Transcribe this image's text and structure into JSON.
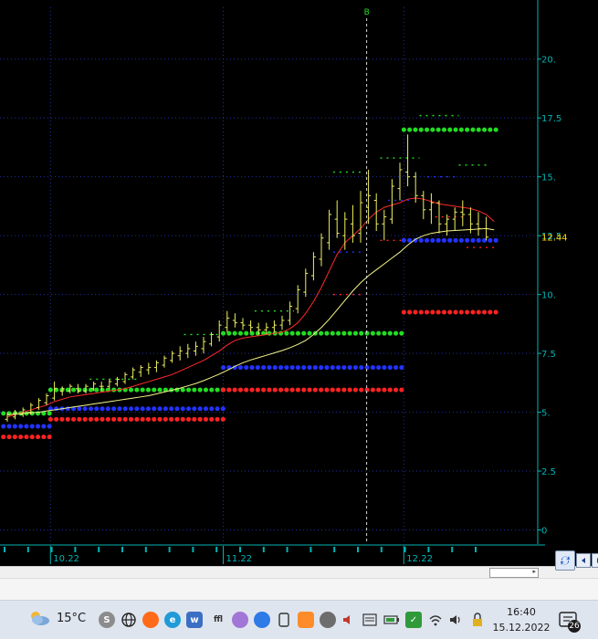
{
  "chart_data": {
    "type": "bar",
    "subtype": "ohlc-with-indicators",
    "title": "",
    "xlabel": "",
    "ylabel": "",
    "ylim": [
      -0.6,
      22.2
    ],
    "y_ticks": [
      0,
      2.5,
      5,
      7.5,
      10,
      12.5,
      15,
      17.5,
      20
    ],
    "y_tick_labels": [
      "0",
      "2.5",
      "5.",
      "7.5",
      "10.",
      "12.5",
      "15.",
      "17.5",
      "20."
    ],
    "last_price": 12.44,
    "last_price_label": "12.44",
    "x_tick_labels": [
      {
        "label": "10.22",
        "bar": 6
      },
      {
        "label": "11.22",
        "bar": 28
      },
      {
        "label": "12.22",
        "bar": 51
      }
    ],
    "event_marker": {
      "bar": 46,
      "label": "B"
    },
    "candles": [
      {
        "o": 4.7,
        "h": 5.0,
        "l": 4.6,
        "c": 4.9
      },
      {
        "o": 4.8,
        "h": 5.1,
        "l": 4.7,
        "c": 5.0
      },
      {
        "o": 4.9,
        "h": 5.2,
        "l": 4.8,
        "c": 5.1
      },
      {
        "o": 5.0,
        "h": 5.4,
        "l": 4.9,
        "c": 5.3
      },
      {
        "o": 5.2,
        "h": 5.6,
        "l": 5.1,
        "c": 5.5
      },
      {
        "o": 5.4,
        "h": 5.8,
        "l": 5.3,
        "c": 5.7
      },
      {
        "o": 5.6,
        "h": 6.3,
        "l": 5.5,
        "c": 6.0
      },
      {
        "o": 5.9,
        "h": 6.1,
        "l": 5.7,
        "c": 6.0
      },
      {
        "o": 5.9,
        "h": 6.2,
        "l": 5.8,
        "c": 6.1
      },
      {
        "o": 6.0,
        "h": 6.2,
        "l": 5.8,
        "c": 5.9
      },
      {
        "o": 5.9,
        "h": 6.2,
        "l": 5.8,
        "c": 6.1
      },
      {
        "o": 6.0,
        "h": 6.3,
        "l": 5.9,
        "c": 6.2
      },
      {
        "o": 6.1,
        "h": 6.3,
        "l": 5.9,
        "c": 6.1
      },
      {
        "o": 6.1,
        "h": 6.4,
        "l": 6.0,
        "c": 6.3
      },
      {
        "o": 6.2,
        "h": 6.5,
        "l": 6.1,
        "c": 6.4
      },
      {
        "o": 6.3,
        "h": 6.7,
        "l": 6.2,
        "c": 6.6
      },
      {
        "o": 6.5,
        "h": 6.9,
        "l": 6.4,
        "c": 6.8
      },
      {
        "o": 6.7,
        "h": 7.0,
        "l": 6.5,
        "c": 6.9
      },
      {
        "o": 6.8,
        "h": 7.1,
        "l": 6.6,
        "c": 6.9
      },
      {
        "o": 6.9,
        "h": 7.2,
        "l": 6.7,
        "c": 7.1
      },
      {
        "o": 7.0,
        "h": 7.4,
        "l": 6.9,
        "c": 7.3
      },
      {
        "o": 7.2,
        "h": 7.6,
        "l": 7.1,
        "c": 7.5
      },
      {
        "o": 7.4,
        "h": 7.8,
        "l": 7.2,
        "c": 7.6
      },
      {
        "o": 7.5,
        "h": 7.9,
        "l": 7.3,
        "c": 7.7
      },
      {
        "o": 7.6,
        "h": 8.0,
        "l": 7.4,
        "c": 7.8
      },
      {
        "o": 7.7,
        "h": 8.2,
        "l": 7.5,
        "c": 8.0
      },
      {
        "o": 7.9,
        "h": 8.4,
        "l": 7.8,
        "c": 8.3
      },
      {
        "o": 8.2,
        "h": 8.9,
        "l": 8.0,
        "c": 8.7
      },
      {
        "o": 8.6,
        "h": 9.3,
        "l": 8.4,
        "c": 9.0
      },
      {
        "o": 8.9,
        "h": 9.2,
        "l": 8.6,
        "c": 8.8
      },
      {
        "o": 8.8,
        "h": 9.0,
        "l": 8.5,
        "c": 8.7
      },
      {
        "o": 8.7,
        "h": 8.9,
        "l": 8.4,
        "c": 8.6
      },
      {
        "o": 8.6,
        "h": 8.8,
        "l": 8.3,
        "c": 8.5
      },
      {
        "o": 8.5,
        "h": 8.8,
        "l": 8.3,
        "c": 8.6
      },
      {
        "o": 8.6,
        "h": 8.9,
        "l": 8.4,
        "c": 8.7
      },
      {
        "o": 8.7,
        "h": 9.1,
        "l": 8.5,
        "c": 8.9
      },
      {
        "o": 8.9,
        "h": 9.7,
        "l": 8.7,
        "c": 9.5
      },
      {
        "o": 9.4,
        "h": 10.4,
        "l": 9.2,
        "c": 10.2
      },
      {
        "o": 10.1,
        "h": 11.1,
        "l": 9.9,
        "c": 10.9
      },
      {
        "o": 10.8,
        "h": 11.8,
        "l": 10.6,
        "c": 11.6
      },
      {
        "o": 11.5,
        "h": 12.6,
        "l": 11.2,
        "c": 12.4
      },
      {
        "o": 12.2,
        "h": 13.6,
        "l": 11.9,
        "c": 13.4
      },
      {
        "o": 13.2,
        "h": 14.0,
        "l": 12.4,
        "c": 12.6
      },
      {
        "o": 12.5,
        "h": 13.5,
        "l": 11.9,
        "c": 13.2
      },
      {
        "o": 13.0,
        "h": 13.8,
        "l": 12.2,
        "c": 12.5
      },
      {
        "o": 12.6,
        "h": 14.4,
        "l": 12.2,
        "c": 13.9
      },
      {
        "o": 13.7,
        "h": 15.3,
        "l": 13.0,
        "c": 14.2
      },
      {
        "o": 14.0,
        "h": 14.3,
        "l": 12.7,
        "c": 13.0
      },
      {
        "o": 13.0,
        "h": 13.6,
        "l": 12.3,
        "c": 13.3
      },
      {
        "o": 13.2,
        "h": 14.9,
        "l": 13.0,
        "c": 14.6
      },
      {
        "o": 14.5,
        "h": 15.6,
        "l": 14.0,
        "c": 15.3
      },
      {
        "o": 15.2,
        "h": 16.8,
        "l": 14.6,
        "c": 15.0
      },
      {
        "o": 15.0,
        "h": 15.2,
        "l": 13.9,
        "c": 14.2
      },
      {
        "o": 14.2,
        "h": 14.4,
        "l": 13.2,
        "c": 13.6
      },
      {
        "o": 13.6,
        "h": 14.3,
        "l": 13.0,
        "c": 13.9
      },
      {
        "o": 13.9,
        "h": 14.0,
        "l": 12.6,
        "c": 13.0
      },
      {
        "o": 13.0,
        "h": 13.4,
        "l": 12.5,
        "c": 13.2
      },
      {
        "o": 13.2,
        "h": 13.7,
        "l": 12.7,
        "c": 13.5
      },
      {
        "o": 13.5,
        "h": 14.0,
        "l": 12.9,
        "c": 13.4
      },
      {
        "o": 13.4,
        "h": 13.7,
        "l": 12.6,
        "c": 13.0
      },
      {
        "o": 13.0,
        "h": 13.5,
        "l": 12.5,
        "c": 12.8
      },
      {
        "o": 12.8,
        "h": 13.3,
        "l": 12.3,
        "c": 12.44
      }
    ],
    "series": [
      {
        "role": "moving-average-fast",
        "color": "#ff2a2a",
        "values": [
          4.8,
          4.9,
          5.0,
          5.1,
          5.2,
          5.3,
          5.45,
          5.55,
          5.65,
          5.7,
          5.75,
          5.8,
          5.85,
          5.9,
          5.95,
          6.0,
          6.1,
          6.2,
          6.3,
          6.4,
          6.5,
          6.6,
          6.75,
          6.9,
          7.05,
          7.2,
          7.4,
          7.6,
          7.85,
          8.05,
          8.15,
          8.2,
          8.25,
          8.3,
          8.35,
          8.4,
          8.55,
          8.8,
          9.2,
          9.7,
          10.3,
          11.0,
          11.7,
          12.2,
          12.5,
          12.8,
          13.2,
          13.5,
          13.7,
          13.8,
          13.9,
          14.05,
          14.1,
          14.05,
          13.95,
          13.85,
          13.8,
          13.75,
          13.7,
          13.65,
          13.55,
          13.4,
          13.1
        ]
      },
      {
        "role": "moving-average-slow",
        "color": "#f5f58c",
        "values": [
          4.9,
          4.92,
          4.95,
          4.98,
          5.0,
          5.05,
          5.1,
          5.15,
          5.2,
          5.25,
          5.3,
          5.35,
          5.4,
          5.45,
          5.5,
          5.55,
          5.6,
          5.65,
          5.7,
          5.78,
          5.86,
          5.94,
          6.02,
          6.12,
          6.22,
          6.34,
          6.48,
          6.62,
          6.78,
          6.95,
          7.1,
          7.22,
          7.32,
          7.42,
          7.52,
          7.62,
          7.74,
          7.88,
          8.05,
          8.3,
          8.6,
          8.95,
          9.35,
          9.75,
          10.15,
          10.5,
          10.8,
          11.05,
          11.3,
          11.55,
          11.8,
          12.1,
          12.35,
          12.5,
          12.6,
          12.65,
          12.7,
          12.72,
          12.74,
          12.76,
          12.78,
          12.8,
          12.75
        ]
      }
    ],
    "levels": [
      {
        "from_bar": 0,
        "to_bar": 6,
        "value": 4.95,
        "color": "#22dd22",
        "style": "dot"
      },
      {
        "from_bar": 0,
        "to_bar": 6,
        "value": 4.4,
        "color": "#2233ff",
        "style": "dot"
      },
      {
        "from_bar": 0,
        "to_bar": 6,
        "value": 3.95,
        "color": "#ff2222",
        "style": "dot"
      },
      {
        "from_bar": 6,
        "to_bar": 28,
        "value": 5.95,
        "color": "#22dd22",
        "style": "dot"
      },
      {
        "from_bar": 6,
        "to_bar": 28,
        "value": 5.15,
        "color": "#2233ff",
        "style": "dot"
      },
      {
        "from_bar": 6,
        "to_bar": 28,
        "value": 4.7,
        "color": "#ff2222",
        "style": "dot"
      },
      {
        "from_bar": 28,
        "to_bar": 51,
        "value": 8.35,
        "color": "#22dd22",
        "style": "dot"
      },
      {
        "from_bar": 28,
        "to_bar": 51,
        "value": 6.9,
        "color": "#2233ff",
        "style": "dot"
      },
      {
        "from_bar": 28,
        "to_bar": 51,
        "value": 5.95,
        "color": "#ff2222",
        "style": "dot"
      },
      {
        "from_bar": 51,
        "to_bar": 63,
        "value": 17.0,
        "color": "#22dd22",
        "style": "dot"
      },
      {
        "from_bar": 51,
        "to_bar": 63,
        "value": 12.3,
        "color": "#2233ff",
        "style": "dot"
      },
      {
        "from_bar": 51,
        "to_bar": 63,
        "value": 9.25,
        "color": "#ff2222",
        "style": "dot"
      },
      {
        "from_bar": 11,
        "to_bar": 17,
        "value": 6.4,
        "color": "#22dd22",
        "style": "dash"
      },
      {
        "from_bar": 23,
        "to_bar": 29,
        "value": 8.3,
        "color": "#22dd22",
        "style": "dash"
      },
      {
        "from_bar": 32,
        "to_bar": 37,
        "value": 9.3,
        "color": "#22dd22",
        "style": "dash"
      },
      {
        "from_bar": 42,
        "to_bar": 46,
        "value": 15.2,
        "color": "#22dd22",
        "style": "dash"
      },
      {
        "from_bar": 48,
        "to_bar": 53,
        "value": 15.8,
        "color": "#22dd22",
        "style": "dash"
      },
      {
        "from_bar": 53,
        "to_bar": 58,
        "value": 17.6,
        "color": "#22dd22",
        "style": "dash"
      },
      {
        "from_bar": 58,
        "to_bar": 62,
        "value": 15.5,
        "color": "#22dd22",
        "style": "dash"
      },
      {
        "from_bar": 42,
        "to_bar": 46,
        "value": 11.8,
        "color": "#2233ff",
        "style": "dash"
      },
      {
        "from_bar": 49,
        "to_bar": 52,
        "value": 14.0,
        "color": "#2233ff",
        "style": "dash"
      },
      {
        "from_bar": 54,
        "to_bar": 58,
        "value": 15.0,
        "color": "#2233ff",
        "style": "dash"
      },
      {
        "from_bar": 42,
        "to_bar": 46,
        "value": 10.0,
        "color": "#ff2222",
        "style": "dash"
      },
      {
        "from_bar": 48,
        "to_bar": 51,
        "value": 12.3,
        "color": "#ff2222",
        "style": "dash"
      },
      {
        "from_bar": 55,
        "to_bar": 59,
        "value": 13.3,
        "color": "#ff2222",
        "style": "dash"
      },
      {
        "from_bar": 59,
        "to_bar": 63,
        "value": 12.0,
        "color": "#ff2222",
        "style": "dash"
      }
    ],
    "grid": true,
    "colors": {
      "background": "#000000",
      "grid": "#1f2fa0",
      "axis_text": "#00b5b5",
      "candle": "#f0f060",
      "last_price": "#ffd400",
      "event_line": "#d8d8d8",
      "event_label": "#22dd22"
    }
  },
  "taskbar": {
    "temperature": "15°C",
    "time": "16:40",
    "date": "15.12.2022",
    "notification_count": "26",
    "icons": [
      "weather-icon",
      "skype-icon",
      "globe-icon",
      "firefox-icon",
      "edge-icon",
      "teams-icon",
      "ticker-icon",
      "feather-icon",
      "zoom-icon",
      "phone-link-icon",
      "office-icon",
      "meet-icon",
      "speaker-warning-icon",
      "news-icon",
      "battery-icon",
      "shield-icon",
      "wifi-icon",
      "volume-icon",
      "lock-icon",
      "notification-icon"
    ]
  }
}
